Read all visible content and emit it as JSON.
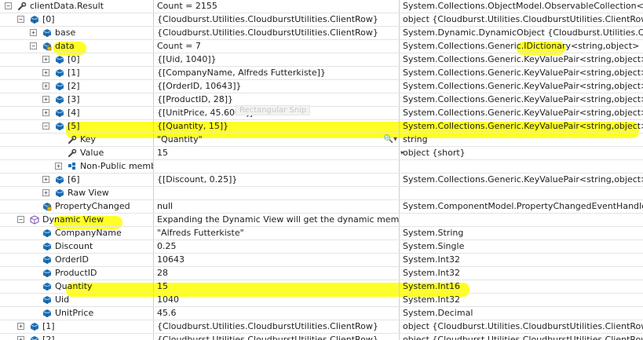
{
  "rows": [
    {
      "indent": 0,
      "toggle": "−",
      "icon": "wrench-icon",
      "name": "clientData.Result",
      "value": "Count = 2155",
      "type": "System.Collections.ObjectModel.ObservableCollection<dy"
    },
    {
      "indent": 1,
      "toggle": "−",
      "icon": "cube-icon",
      "name": "[0]",
      "value": "{Cloudburst.Utilities.CloudburstUtilities.ClientRow}",
      "type": "object {Cloudburst.Utilities.CloudburstUtilities.ClientRow}"
    },
    {
      "indent": 2,
      "toggle": "+",
      "icon": "cube-icon",
      "name": "base",
      "value": "{Cloudburst.Utilities.CloudburstUtilities.ClientRow}",
      "type": "System.Dynamic.DynamicObject {Cloudburst.Utilities.Cloudbu"
    },
    {
      "indent": 2,
      "toggle": "−",
      "icon": "locked-cube-icon",
      "name": "data",
      "value": "Count = 7",
      "type": "System.Collections.Generic.IDictionary<string,object> {Sy"
    },
    {
      "indent": 3,
      "toggle": "+",
      "icon": "cube-icon",
      "name": "[0]",
      "value": "{[Uid, 1040]}",
      "type": "System.Collections.Generic.KeyValuePair<string,object>"
    },
    {
      "indent": 3,
      "toggle": "+",
      "icon": "cube-icon",
      "name": "[1]",
      "value": "{[CompanyName, Alfreds Futterkiste]}",
      "type": "System.Collections.Generic.KeyValuePair<string,object>"
    },
    {
      "indent": 3,
      "toggle": "+",
      "icon": "cube-icon",
      "name": "[2]",
      "value": "{[OrderID, 10643]}",
      "type": "System.Collections.Generic.KeyValuePair<string,object>"
    },
    {
      "indent": 3,
      "toggle": "+",
      "icon": "cube-icon",
      "name": "[3]",
      "value": "{[ProductID, 28]}",
      "type": "System.Collections.Generic.KeyValuePair<string,object>"
    },
    {
      "indent": 3,
      "toggle": "+",
      "icon": "cube-icon",
      "name": "[4]",
      "value": "{[UnitPrice, 45.6000]}",
      "type": "System.Collections.Generic.KeyValuePair<string,object>"
    },
    {
      "indent": 3,
      "toggle": "−",
      "icon": "cube-icon",
      "name": "[5]",
      "value": "{[Quantity, 15]}",
      "type": "System.Collections.Generic.KeyValuePair<string,object>"
    },
    {
      "indent": 4,
      "toggle": "",
      "icon": "wrench-icon",
      "name": "Key",
      "value": "\"Quantity\"",
      "type": "string",
      "magnifier": true
    },
    {
      "indent": 4,
      "toggle": "",
      "icon": "wrench-icon",
      "name": "Value",
      "value": "15",
      "type": "object {short}",
      "dropdown": true
    },
    {
      "indent": 4,
      "toggle": "+",
      "icon": "members-icon",
      "name": "Non-Public members",
      "value": "",
      "type": ""
    },
    {
      "indent": 3,
      "toggle": "+",
      "icon": "cube-icon",
      "name": "[6]",
      "value": "{[Discount, 0.25]}",
      "type": "System.Collections.Generic.KeyValuePair<string,object>"
    },
    {
      "indent": 3,
      "toggle": "+",
      "icon": "cube-icon",
      "name": "Raw View",
      "value": "",
      "type": ""
    },
    {
      "indent": 2,
      "toggle": "",
      "icon": "locked-cube-icon",
      "name": "PropertyChanged",
      "value": "null",
      "type": "System.ComponentModel.PropertyChangedEventHandler"
    },
    {
      "indent": 1,
      "toggle": "−",
      "icon": "dynamic-view-icon",
      "name": "Dynamic View",
      "value": "Expanding the Dynamic View will get the dynamic members",
      "type": ""
    },
    {
      "indent": 2,
      "toggle": "",
      "icon": "cube-icon",
      "name": "CompanyName",
      "value": "\"Alfreds Futterkiste\"",
      "type": "System.String"
    },
    {
      "indent": 2,
      "toggle": "",
      "icon": "cube-icon",
      "name": "Discount",
      "value": "0.25",
      "type": "System.Single"
    },
    {
      "indent": 2,
      "toggle": "",
      "icon": "cube-icon",
      "name": "OrderID",
      "value": "10643",
      "type": "System.Int32"
    },
    {
      "indent": 2,
      "toggle": "",
      "icon": "cube-icon",
      "name": "ProductID",
      "value": "28",
      "type": "System.Int32"
    },
    {
      "indent": 2,
      "toggle": "",
      "icon": "cube-icon",
      "name": "Quantity",
      "value": "15",
      "type": "System.Int16"
    },
    {
      "indent": 2,
      "toggle": "",
      "icon": "cube-icon",
      "name": "Uid",
      "value": "1040",
      "type": "System.Int32"
    },
    {
      "indent": 2,
      "toggle": "",
      "icon": "cube-icon",
      "name": "UnitPrice",
      "value": "45.6",
      "type": "System.Decimal"
    },
    {
      "indent": 1,
      "toggle": "+",
      "icon": "cube-icon",
      "name": "[1]",
      "value": "{Cloudburst.Utilities.CloudburstUtilities.ClientRow}",
      "type": "object {Cloudburst.Utilities.CloudburstUtilities.ClientRow}"
    },
    {
      "indent": 1,
      "toggle": "+",
      "icon": "cube-icon",
      "name": "[2]",
      "value": "{Cloudburst.Utilities.CloudburstUtilities.ClientRow}",
      "type": "object {Cloudburst.Utilities.CloudburstUtilities.ClientRow}"
    }
  ],
  "ghost_label": "Rectangular Snip",
  "colors": {
    "highlight": "#ffff00",
    "cube": "#1f6fb2",
    "wrench": "#444444",
    "dynamic": "#8a5fb5"
  }
}
